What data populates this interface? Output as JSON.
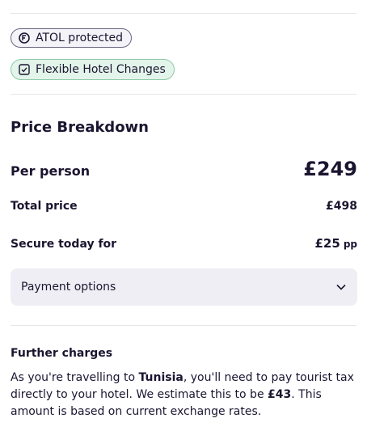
{
  "badges": {
    "atol": {
      "label": "ATOL protected",
      "icon": "atol-icon"
    },
    "flexible": {
      "label": "Flexible Hotel Changes",
      "icon": "checkbox-icon"
    }
  },
  "price_breakdown": {
    "title": "Price Breakdown",
    "per_person": {
      "label": "Per person",
      "value": "£249"
    },
    "total": {
      "label": "Total price",
      "value": "£498"
    },
    "secure": {
      "label": "Secure today for",
      "value": "£25",
      "unit": "pp"
    }
  },
  "payment_options": {
    "label": "Payment options",
    "icon": "chevron-down-icon"
  },
  "further_charges": {
    "title": "Further charges",
    "text_1": "As you're travelling to ",
    "destination": "Tunisia",
    "text_2": ", you'll need to pay tourist tax directly to your hotel. We estimate this to be ",
    "amount": "£43",
    "text_3": ". This amount is based on current exchange rates."
  },
  "colors": {
    "text": "#1b1530",
    "flexible_badge_bg": "#e3f4ea",
    "flexible_badge_border": "#8fc9aa",
    "payment_bg": "#efeef4"
  }
}
